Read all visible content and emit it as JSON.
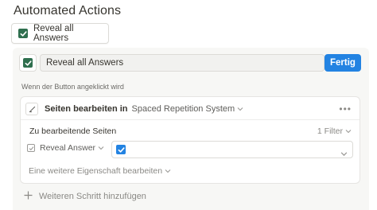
{
  "title": "Automated Actions",
  "preview_button": {
    "label": "Reveal all Answers",
    "checked": true
  },
  "button_name": {
    "value": "Reveal all Answers"
  },
  "done_label": "Fertig",
  "trigger_label": "Wenn der Button angeklickt wird",
  "step": {
    "title": "Seiten bearbeiten in",
    "database": "Spaced Repetition System",
    "pages_label": "Zu bearbeitende Seiten",
    "filter_label": "1 Filter",
    "property": {
      "name": "Reveal Answer",
      "value_checked": true
    },
    "add_property_label": "Eine weitere Eigenschaft bearbeiten"
  },
  "add_step_label": "Weiteren Schritt hinzufügen",
  "colors": {
    "checkbox_green": "#2f6f4e",
    "accent_blue": "#2383e2"
  }
}
